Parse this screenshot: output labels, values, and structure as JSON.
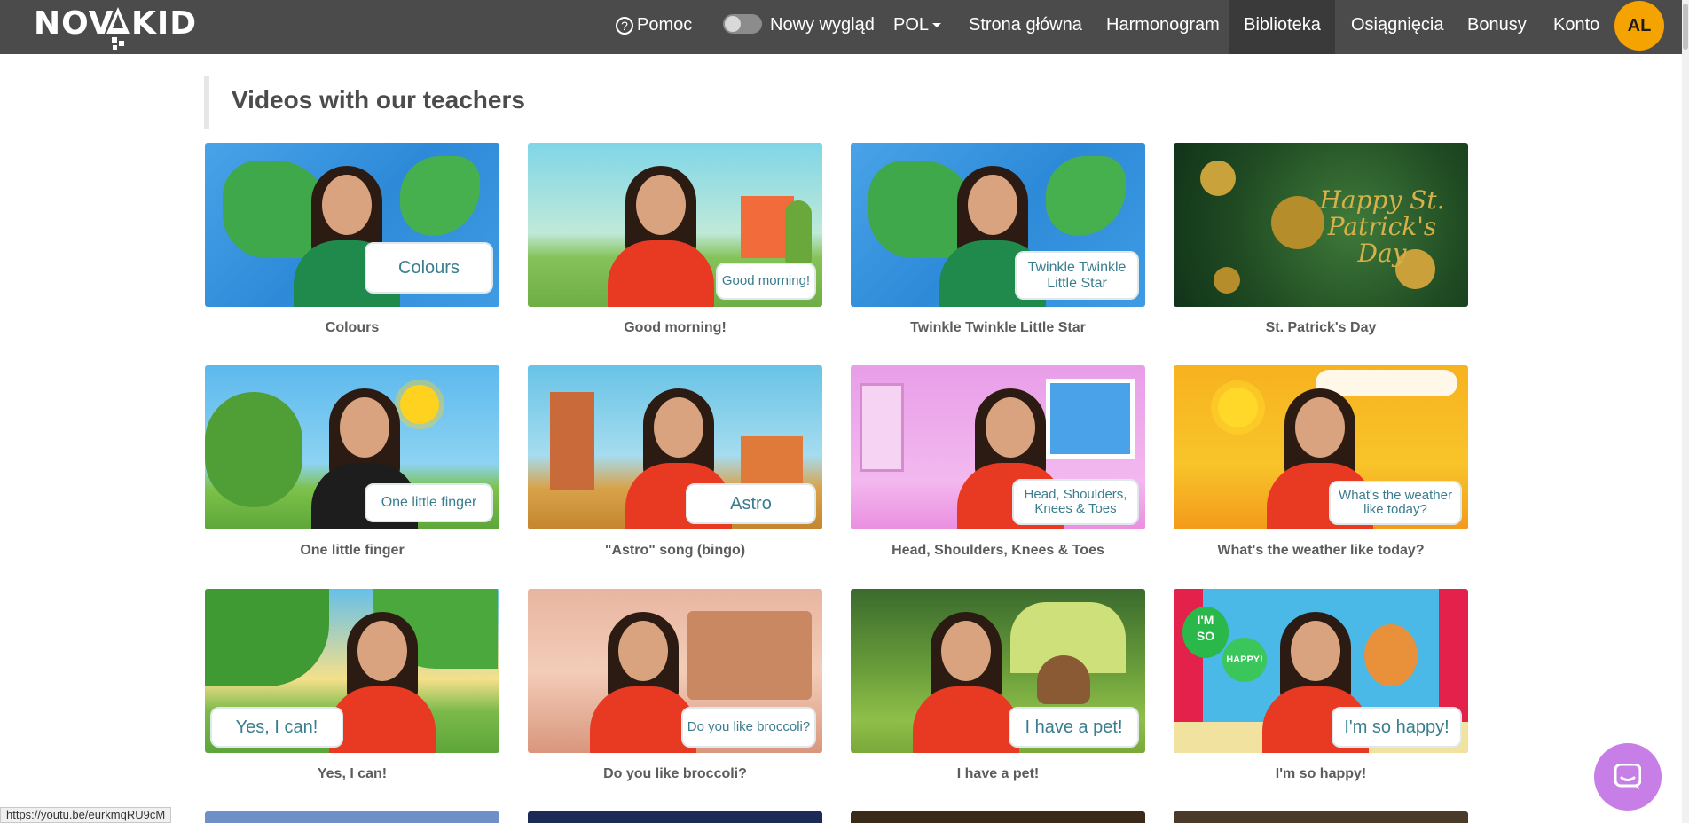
{
  "brand": {
    "logo": "NOVAKID"
  },
  "nav": {
    "help": "Pomoc",
    "new_look": "Nowy wygląd",
    "language": "POL",
    "home": "Strona główna",
    "schedule": "Harmonogram",
    "library": "Biblioteka",
    "achievements": "Osiągnięcia",
    "bonuses": "Bonusy",
    "account": "Konto",
    "avatar_initials": "AL"
  },
  "section": {
    "title": "Videos with our teachers"
  },
  "videos": [
    {
      "title": "Colours",
      "overlay": "Colours"
    },
    {
      "title": "Good morning!",
      "overlay": "Good morning!"
    },
    {
      "title": "Twinkle Twinkle Little Star",
      "overlay": "Twinkle Twinkle Little Star"
    },
    {
      "title": "St. Patrick's Day",
      "overlay": "Happy St. Patrick's Day"
    },
    {
      "title": "One little finger",
      "overlay": "One little finger"
    },
    {
      "title": "\"Astro\" song (bingo)",
      "overlay": "Astro"
    },
    {
      "title": "Head, Shoulders, Knees & Toes",
      "overlay": "Head, Shoulders, Knees & Toes"
    },
    {
      "title": "What's the weather like today?",
      "overlay": "What's the weather like today?"
    },
    {
      "title": "Yes, I can!",
      "overlay": "Yes, I can!"
    },
    {
      "title": "Do you like broccoli?",
      "overlay": "Do you like broccoli?"
    },
    {
      "title": "I have a pet!",
      "overlay": "I have a pet!"
    },
    {
      "title": "I'm so happy!",
      "overlay": "I'm so happy!"
    }
  ],
  "status_bar": {
    "url": "https://youtu.be/eurkmqRU9cM"
  },
  "colors": {
    "nav_bg": "#4b4b4b",
    "avatar": "#f5a300",
    "chat": "#c77ee6",
    "caption": "#5c5c5c"
  }
}
